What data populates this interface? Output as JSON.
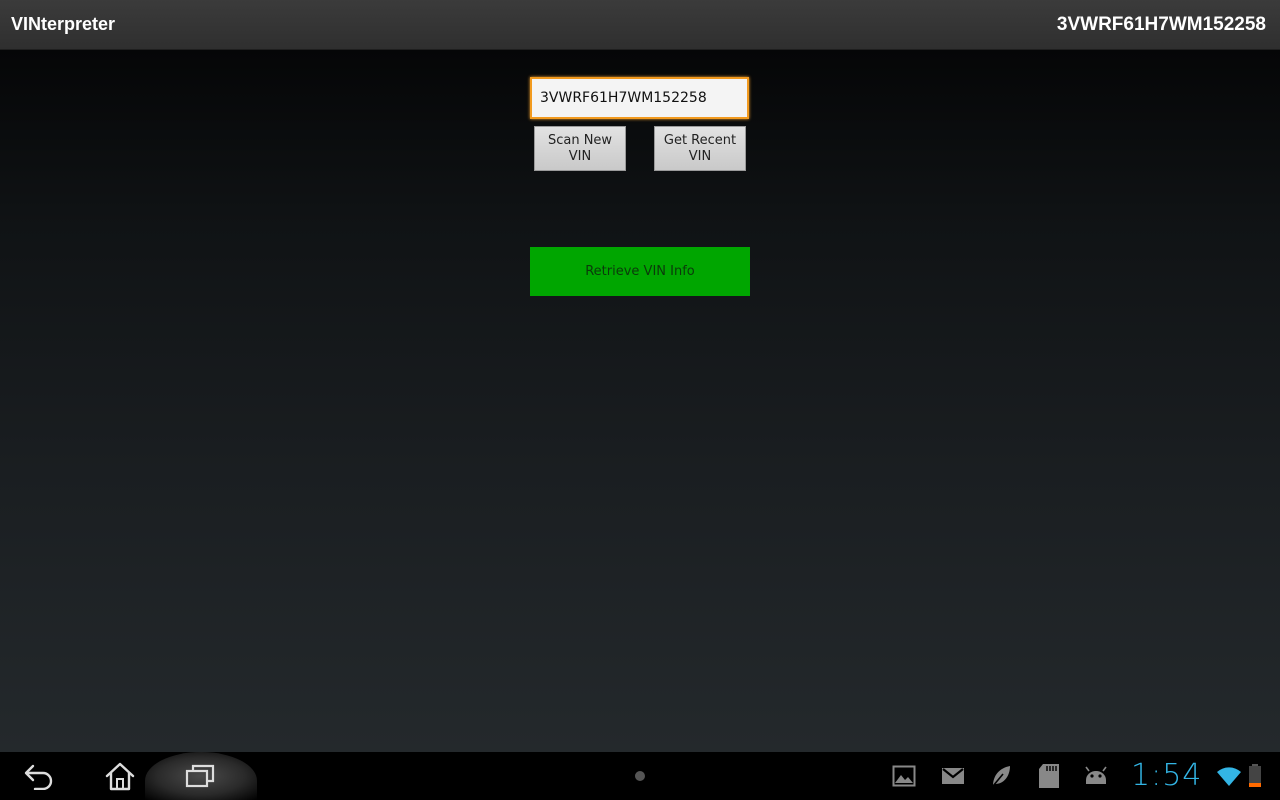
{
  "action_bar": {
    "app_title": "VINterpreter",
    "current_vin": "3VWRF61H7WM152258"
  },
  "form": {
    "vin_value": "3VWRF61H7WM152258",
    "scan_button": "Scan New\nVIN",
    "recent_button": "Get Recent\nVIN",
    "retrieve_button": "Retrieve VIN Info"
  },
  "status_bar": {
    "clock": "1:54",
    "icons": [
      "gallery-icon",
      "gmail-icon",
      "leaf-icon",
      "sd-card-icon",
      "android-debug-icon",
      "wifi-icon",
      "battery-icon"
    ]
  },
  "colors": {
    "accent_focus": "#f29a1e",
    "retrieve_green": "#00a600",
    "clock_blue": "#33b5e5"
  }
}
